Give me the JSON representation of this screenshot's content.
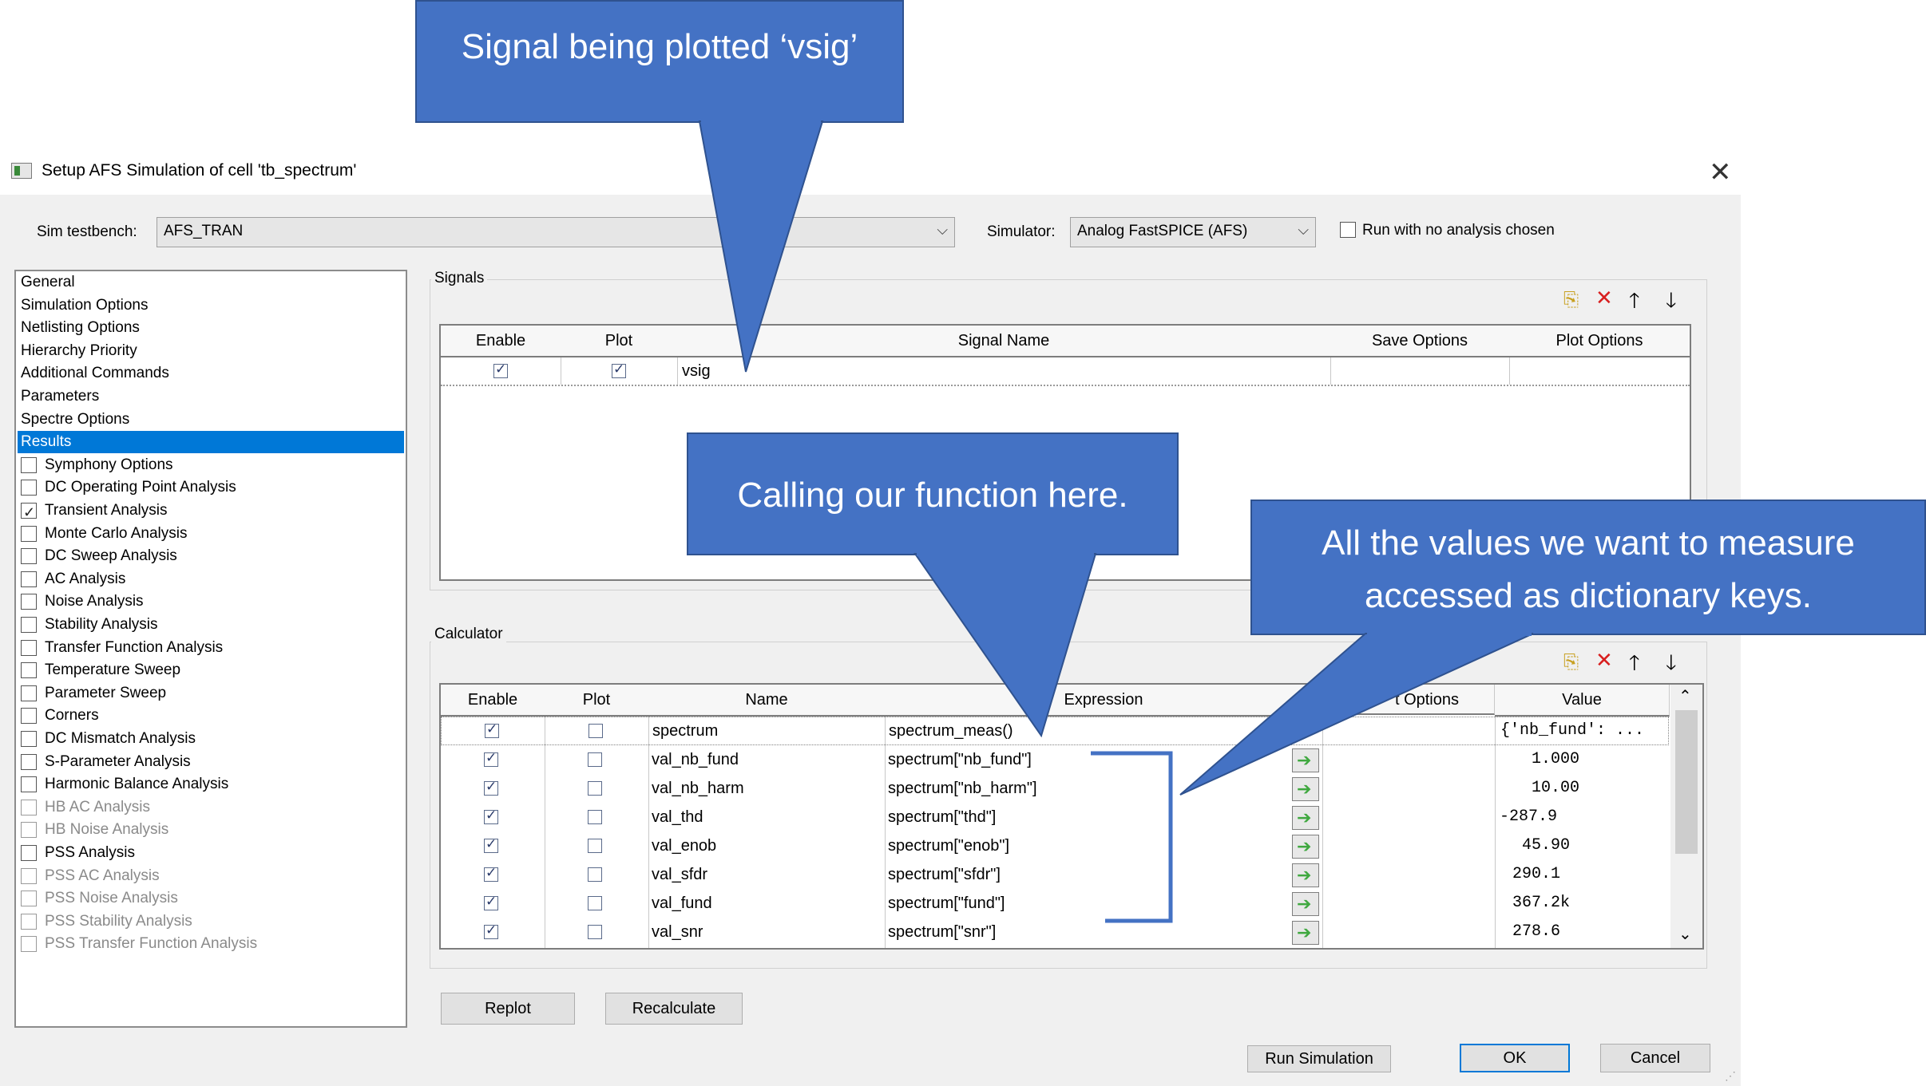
{
  "window": {
    "title": "Setup AFS Simulation of cell 'tb_spectrum'"
  },
  "top": {
    "testbench_label": "Sim testbench:",
    "testbench_value": "AFS_TRAN",
    "simulator_label": "Simulator:",
    "simulator_value": "Analog FastSPICE (AFS)",
    "run_no_analysis_label": "Run with no analysis chosen"
  },
  "sidebar": {
    "items": [
      {
        "label": "General"
      },
      {
        "label": "Simulation Options"
      },
      {
        "label": "Netlisting Options"
      },
      {
        "label": "Hierarchy Priority"
      },
      {
        "label": "Additional Commands"
      },
      {
        "label": "Parameters"
      },
      {
        "label": "Spectre Options"
      },
      {
        "label": "Results"
      },
      {
        "label": "Symphony Options"
      },
      {
        "label": "DC Operating Point Analysis"
      },
      {
        "label": "Transient Analysis"
      },
      {
        "label": "Monte Carlo Analysis"
      },
      {
        "label": "DC Sweep Analysis"
      },
      {
        "label": "AC Analysis"
      },
      {
        "label": "Noise Analysis"
      },
      {
        "label": "Stability Analysis"
      },
      {
        "label": "Transfer Function Analysis"
      },
      {
        "label": "Temperature Sweep"
      },
      {
        "label": "Parameter Sweep"
      },
      {
        "label": "Corners"
      },
      {
        "label": "DC Mismatch Analysis"
      },
      {
        "label": "S-Parameter Analysis"
      },
      {
        "label": "Harmonic Balance Analysis"
      },
      {
        "label": "HB AC Analysis"
      },
      {
        "label": "HB Noise Analysis"
      },
      {
        "label": "PSS Analysis"
      },
      {
        "label": "PSS AC Analysis"
      },
      {
        "label": "PSS Noise Analysis"
      },
      {
        "label": "PSS Stability Analysis"
      },
      {
        "label": "PSS Transfer Function Analysis"
      }
    ]
  },
  "signals": {
    "group_label": "Signals",
    "columns": [
      "Enable",
      "Plot",
      "Signal Name",
      "Save Options",
      "Plot Options"
    ],
    "rows": [
      {
        "name": "vsig"
      }
    ]
  },
  "calculator": {
    "group_label": "Calculator",
    "columns": [
      "Enable",
      "Plot",
      "Name",
      "Expression",
      "t Options",
      "Value"
    ],
    "rows": [
      {
        "name": "spectrum",
        "expr": "spectrum_meas()",
        "value": "{'nb_fund': ..."
      },
      {
        "name": "val_nb_fund",
        "expr": "spectrum[\"nb_fund\"]",
        "value": "1.000"
      },
      {
        "name": "val_nb_harm",
        "expr": "spectrum[\"nb_harm\"]",
        "value": "10.00"
      },
      {
        "name": "val_thd",
        "expr": "spectrum[\"thd\"]",
        "value": "-287.9"
      },
      {
        "name": "val_enob",
        "expr": "spectrum[\"enob\"]",
        "value": "45.90"
      },
      {
        "name": "val_sfdr",
        "expr": "spectrum[\"sfdr\"]",
        "value": "290.1"
      },
      {
        "name": "val_fund",
        "expr": "spectrum[\"fund\"]",
        "value": "367.2k"
      },
      {
        "name": "val_snr",
        "expr": "spectrum[\"snr\"]",
        "value": "278.6"
      }
    ]
  },
  "buttons": {
    "replot": "Replot",
    "recalculate": "Recalculate",
    "run_simulation": "Run Simulation",
    "ok": "OK",
    "cancel": "Cancel"
  },
  "callouts": {
    "signal": "Signal being plotted ‘vsig’",
    "function": "Calling our function here.",
    "values_line1": "All the values we want to measure",
    "values_line2": "accessed as dictionary keys."
  },
  "colors": {
    "callout": "#4472c4",
    "selection": "#0078d7",
    "bracket": "#4472c4"
  }
}
